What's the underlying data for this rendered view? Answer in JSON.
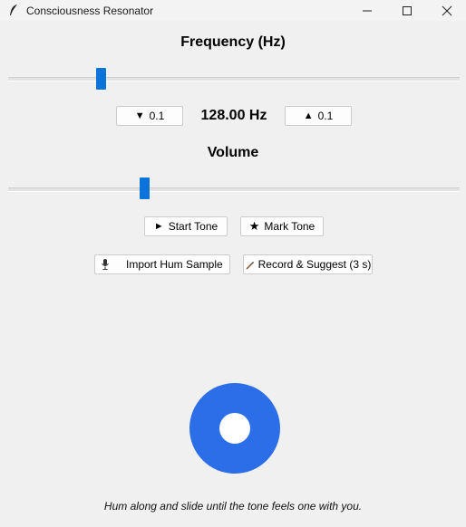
{
  "window": {
    "title": "Consciousness Resonator",
    "icon": "feather-icon",
    "controls": [
      "minimize-icon",
      "maximize-icon",
      "close-icon"
    ]
  },
  "frequency": {
    "heading": "Frequency (Hz)",
    "readout": "128.00 Hz",
    "decrement_label": "0.1",
    "decrement_icon": "triangle-down-icon",
    "increment_label": "0.1",
    "increment_icon": "triangle-up-icon"
  },
  "volume": {
    "heading": "Volume"
  },
  "actions": {
    "start_label": "Start Tone",
    "start_icon": "play-icon",
    "mark_label": "Mark Tone",
    "mark_icon": "star-icon",
    "import_label": "Import Hum Sample",
    "import_icon": "microphone-icon",
    "record_label": "Record & Suggest (3 s)",
    "record_icon": "pencil-icon"
  },
  "visual": {
    "ring_color": "#2b6ee8",
    "accent": "#0a74da"
  },
  "caption": "Hum along and slide until the tone feels one with you."
}
